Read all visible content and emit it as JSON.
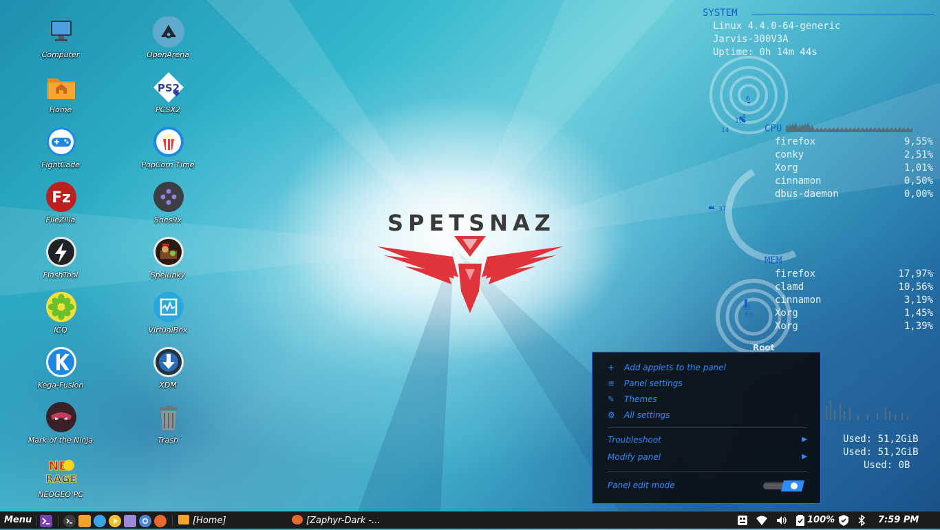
{
  "desktop": {
    "icons": [
      {
        "label": "Computer",
        "icon": "computer-icon"
      },
      {
        "label": "OpenArena",
        "icon": "openarena-icon"
      },
      {
        "label": "Home",
        "icon": "home-folder-icon"
      },
      {
        "label": "PCSX2",
        "icon": "pcsx2-icon"
      },
      {
        "label": "FightCade",
        "icon": "fightcade-icon"
      },
      {
        "label": "PopCorn Time",
        "icon": "popcorn-time-icon"
      },
      {
        "label": "FileZilla",
        "icon": "filezilla-icon"
      },
      {
        "label": "Snes9x",
        "icon": "snes9x-icon"
      },
      {
        "label": "FlashTool",
        "icon": "flashtool-icon"
      },
      {
        "label": "Spelunky",
        "icon": "spelunky-icon"
      },
      {
        "label": "ICQ",
        "icon": "icq-icon"
      },
      {
        "label": "VirtualBox",
        "icon": "virtualbox-icon"
      },
      {
        "label": "Kega-Fusion",
        "icon": "kega-fusion-icon"
      },
      {
        "label": "XDM",
        "icon": "xdm-icon"
      },
      {
        "label": "Mark of the Ninja",
        "icon": "mark-of-the-ninja-icon"
      },
      {
        "label": "Trash",
        "icon": "trash-icon"
      },
      {
        "label": "NEOGEO PC",
        "icon": "neogeo-icon"
      }
    ]
  },
  "wallpaper": {
    "logo_text": "SPETSNAZ",
    "logo_color": "#e0333a"
  },
  "conky": {
    "system_header": "SYSTEM",
    "kernel": "Linux 4.4.0-64-generic",
    "hostname": "Jarvis-300V3A",
    "uptime": "Uptime: 0h 14m 44s",
    "ring_labels": [
      "6",
      "4",
      "10",
      "14"
    ],
    "cpu_header": "CPU",
    "cpu_ring_label": "37",
    "cpu_processes": [
      {
        "name": "firefox",
        "value": "9,55%"
      },
      {
        "name": "conky",
        "value": "2,51%"
      },
      {
        "name": "Xorg",
        "value": "1,01%"
      },
      {
        "name": "cinnamon",
        "value": "0,50%"
      },
      {
        "name": "dbus-daemon",
        "value": "0,00%"
      }
    ],
    "mem_header": "MEM",
    "mem_ring_labels": [
      "55",
      "65"
    ],
    "mem_processes": [
      {
        "name": "firefox",
        "value": "17,97%"
      },
      {
        "name": "clamd",
        "value": "10,56%"
      },
      {
        "name": "cinnamon",
        "value": "3,19%"
      },
      {
        "name": "Xorg",
        "value": "1,45%"
      },
      {
        "name": "Xorg",
        "value": "1,39%"
      }
    ],
    "root_label": "Root",
    "used": [
      "Used: 51,2GiB",
      "Used: 51,2GiB",
      "Used: 0B"
    ],
    "accent": "#1560c4"
  },
  "panel_menu": {
    "items": [
      {
        "label": "Add applets to the panel",
        "icon": "plus-icon"
      },
      {
        "label": "Panel settings",
        "icon": "list-icon"
      },
      {
        "label": "Themes",
        "icon": "brush-icon"
      },
      {
        "label": "All settings",
        "icon": "sliders-icon"
      }
    ],
    "submenus": [
      {
        "label": "Troubleshoot"
      },
      {
        "label": "Modify panel"
      }
    ],
    "edit_mode_label": "Panel edit mode",
    "edit_mode_on": true,
    "accent": "#2f8cff"
  },
  "taskbar": {
    "menu_label": "Menu",
    "windows": [
      {
        "label": "[Home]",
        "icon": "folder-icon"
      },
      {
        "label": "[Zaphyr-Dark -...",
        "icon": "firefox-icon"
      }
    ],
    "battery": "100%",
    "clock": "7:59 PM"
  }
}
